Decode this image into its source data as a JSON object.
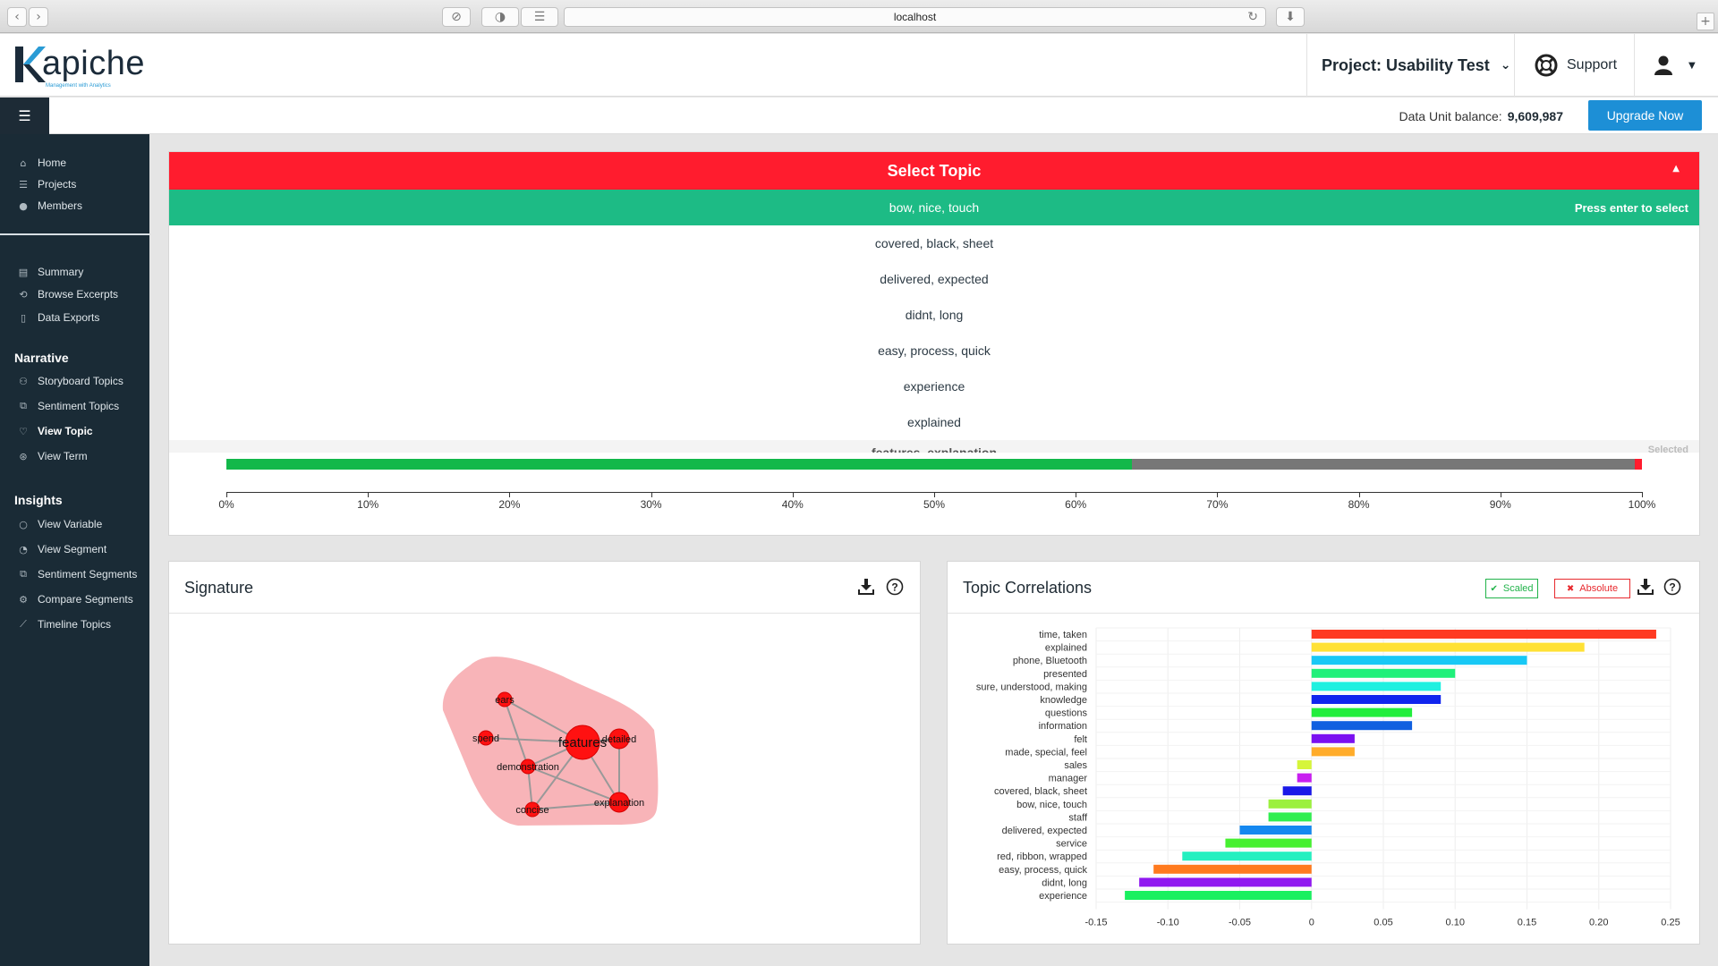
{
  "browser": {
    "url": "localhost"
  },
  "header": {
    "logo": {
      "word": "apiche",
      "tagline": "Management with Analytics"
    },
    "project": "Project: Usability Test",
    "support": "Support"
  },
  "subbar": {
    "balance_label": "Data Unit balance:",
    "balance_value": "9,609,987",
    "upgrade": "Upgrade Now"
  },
  "sidebar": {
    "top": [
      {
        "label": "Home",
        "icon": "home-icon"
      },
      {
        "label": "Projects",
        "icon": "projects-icon"
      },
      {
        "label": "Members",
        "icon": "members-icon"
      }
    ],
    "analysis": [
      {
        "label": "Summary",
        "icon": "summary-icon"
      },
      {
        "label": "Browse Excerpts",
        "icon": "excerpts-icon"
      },
      {
        "label": "Data Exports",
        "icon": "file-icon"
      }
    ],
    "narrative_title": "Narrative",
    "narrative": [
      {
        "label": "Storyboard Topics",
        "icon": "storyboard-icon"
      },
      {
        "label": "Sentiment Topics",
        "icon": "sentiment-icon"
      },
      {
        "label": "View Topic",
        "icon": "heart-icon",
        "active": true
      },
      {
        "label": "View Term",
        "icon": "term-icon"
      }
    ],
    "insights_title": "Insights",
    "insights": [
      {
        "label": "View Variable",
        "icon": "circle-icon"
      },
      {
        "label": "View Segment",
        "icon": "segment-icon"
      },
      {
        "label": "Sentiment Segments",
        "icon": "sentiment-segments-icon"
      },
      {
        "label": "Compare Segments",
        "icon": "compare-icon"
      },
      {
        "label": "Timeline Topics",
        "icon": "timeline-icon"
      }
    ]
  },
  "topic_select": {
    "header": "Select Topic",
    "hint": "Press enter to select",
    "selected_hint": "Selected",
    "options": [
      "bow, nice, touch",
      "covered, black, sheet",
      "delivered, expected",
      "didnt, long",
      "easy, process, quick",
      "experience",
      "explained",
      "features, explanation"
    ],
    "sentiment_bar": {
      "positive": 0.64,
      "neutral": 0.355,
      "negative": 0.005,
      "colors": {
        "positive": "#12b84a",
        "neutral": "#777777",
        "negative": "#ff1c2e"
      }
    },
    "axis_ticks": [
      "0%",
      "10%",
      "20%",
      "30%",
      "40%",
      "50%",
      "60%",
      "70%",
      "80%",
      "90%",
      "100%"
    ]
  },
  "signature": {
    "title": "Signature",
    "nodes": [
      {
        "label": "features",
        "big": true
      },
      {
        "label": "ears"
      },
      {
        "label": "spend"
      },
      {
        "label": "detailed"
      },
      {
        "label": "demonstration"
      },
      {
        "label": "concise"
      },
      {
        "label": "explanation"
      }
    ]
  },
  "correlations": {
    "title": "Topic Correlations",
    "scaled_label": "Scaled",
    "absolute_label": "Absolute"
  },
  "chart_data": {
    "type": "bar",
    "orientation": "horizontal",
    "title": "Topic Correlations",
    "categories": [
      "time, taken",
      "explained",
      "phone, Bluetooth",
      "presented",
      "sure, understood, making",
      "knowledge",
      "questions",
      "information",
      "felt",
      "made, special, feel",
      "sales",
      "manager",
      "covered, black, sheet",
      "bow, nice, touch",
      "staff",
      "delivered, expected",
      "service",
      "red, ribbon, wrapped",
      "easy, process, quick",
      "didnt, long",
      "experience"
    ],
    "values": [
      0.24,
      0.19,
      0.15,
      0.1,
      0.09,
      0.09,
      0.07,
      0.07,
      0.03,
      0.03,
      -0.01,
      -0.01,
      -0.02,
      -0.03,
      -0.03,
      -0.05,
      -0.06,
      -0.09,
      -0.11,
      -0.12,
      -0.13
    ],
    "colors": [
      "#ff3a22",
      "#ffe135",
      "#18c8f5",
      "#20f07a",
      "#20f0e0",
      "#1024ee",
      "#22ee3c",
      "#1060e0",
      "#7a10f0",
      "#ffac2a",
      "#d6f53a",
      "#c81ef0",
      "#1a18e8",
      "#9cf03e",
      "#30ee50",
      "#1488f0",
      "#46f030",
      "#24f0c0",
      "#ff7a1e",
      "#9018f0",
      "#1af060"
    ],
    "xlim": [
      -0.15,
      0.25
    ],
    "xticks": [
      "-0.15",
      "-0.10",
      "-0.05",
      "0",
      "0.05",
      "0.10",
      "0.15",
      "0.20",
      "0.25"
    ],
    "grid": true
  }
}
